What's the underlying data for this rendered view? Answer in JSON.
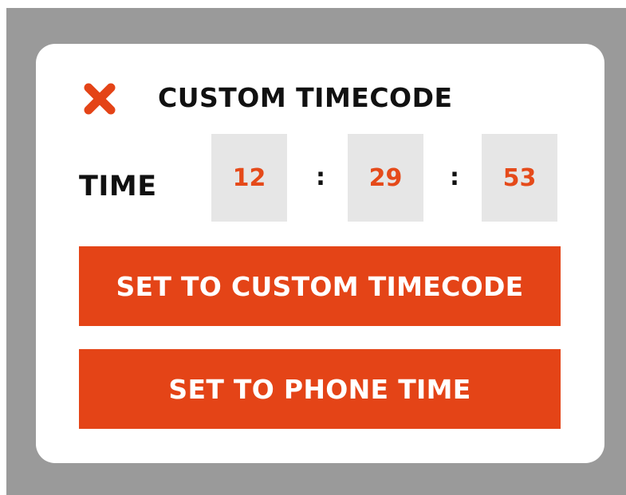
{
  "dialog": {
    "title": "CUSTOM TIMECODE",
    "close_icon": "close-x-icon",
    "time_label": "TIME",
    "time": {
      "hours": "12",
      "minutes": "29",
      "seconds": "53",
      "separator": ":"
    },
    "buttons": {
      "set_custom": "SET TO CUSTOM TIMECODE",
      "set_phone": "SET TO PHONE TIME"
    }
  },
  "colors": {
    "accent": "#e44417",
    "digits": "#e54a1a",
    "field_bg": "#e6e6e6",
    "backdrop": "#9a9a9a",
    "text": "#111111"
  }
}
